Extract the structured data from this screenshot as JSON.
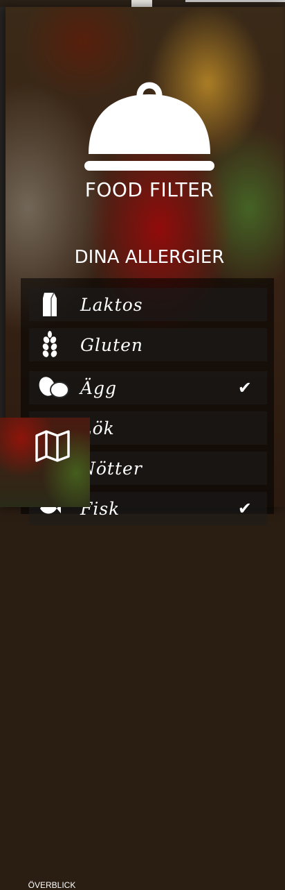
{
  "app": {
    "title": "FOOD FILTER",
    "subtitle": "DINA ALLERGIER"
  },
  "allergies": [
    {
      "label": "Laktos",
      "icon": "milk-carton-icon",
      "checked": false
    },
    {
      "label": "Gluten",
      "icon": "wheat-icon",
      "checked": false
    },
    {
      "label": "Ägg",
      "icon": "eggs-icon",
      "checked": true
    },
    {
      "label": "Lök",
      "icon": "onion-icon",
      "checked": false
    },
    {
      "label": "Nötter",
      "icon": "nuts-icon",
      "checked": false
    },
    {
      "label": "Fisk",
      "icon": "fish-icon",
      "checked": true
    }
  ],
  "nav": {
    "overview_label": "ÖVERBLICK",
    "overview_icon": "map-icon"
  },
  "colors": {
    "text": "#ffffff",
    "list_bg": "rgba(0,0,0,0.55)"
  }
}
